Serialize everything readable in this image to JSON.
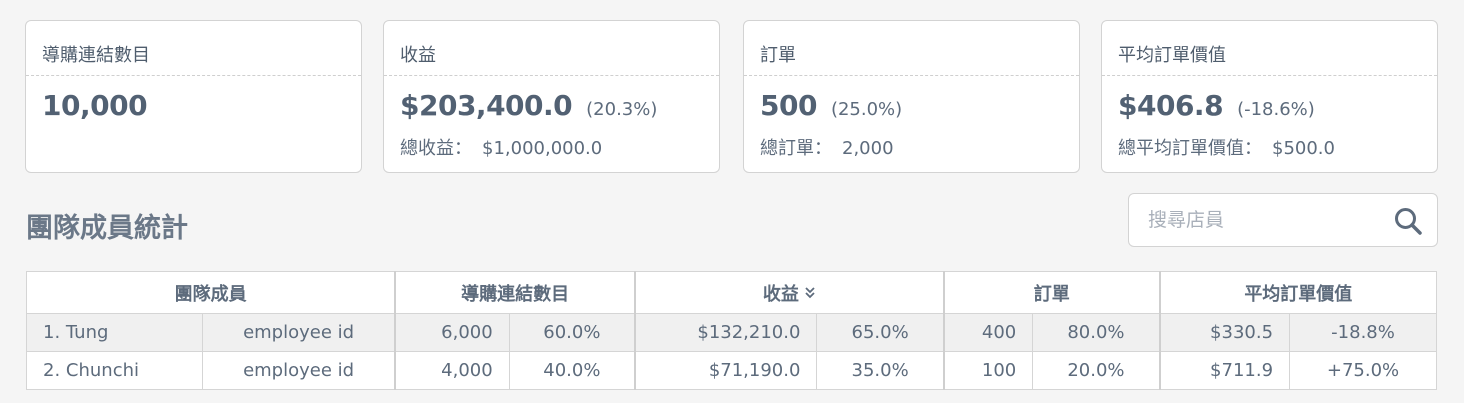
{
  "cards": [
    {
      "title": "導購連結數目",
      "value": "10,000"
    },
    {
      "title": "收益",
      "value": "$203,400.0",
      "pct": "(20.3%)",
      "sub_label": "總收益：",
      "sub_value": "$1,000,000.0"
    },
    {
      "title": "訂單",
      "value": "500",
      "pct": "(25.0%)",
      "sub_label": "總訂單：",
      "sub_value": "2,000"
    },
    {
      "title": "平均訂單價值",
      "value": "$406.8",
      "pct": "(-18.6%)",
      "sub_label": "總平均訂單價值：",
      "sub_value": "$500.0"
    }
  ],
  "section_title": "團隊成員統計",
  "search": {
    "placeholder": "搜尋店員",
    "icon": "search-icon"
  },
  "table": {
    "headers": {
      "member": "團隊成員",
      "links": "導購連結數目",
      "revenue": "收益",
      "orders": "訂單",
      "aov": "平均訂單價值"
    },
    "sort_icon": "double-chevron-down-icon",
    "rows": [
      {
        "name": "1. Tung",
        "employee": "employee id",
        "links": "6,000",
        "links_pct": "60.0%",
        "revenue": "$132,210.0",
        "revenue_pct": "65.0%",
        "orders": "400",
        "orders_pct": "80.0%",
        "aov": "$330.5",
        "aov_pct": "-18.8%"
      },
      {
        "name": "2. Chunchi",
        "employee": "employee id",
        "links": "4,000",
        "links_pct": "40.0%",
        "revenue": "$71,190.0",
        "revenue_pct": "35.0%",
        "orders": "100",
        "orders_pct": "20.0%",
        "aov": "$711.9",
        "aov_pct": "+75.0%"
      }
    ]
  },
  "colors": {
    "text": "#5d6b7c",
    "border": "#d3d3d3",
    "background": "#f5f5f5"
  }
}
